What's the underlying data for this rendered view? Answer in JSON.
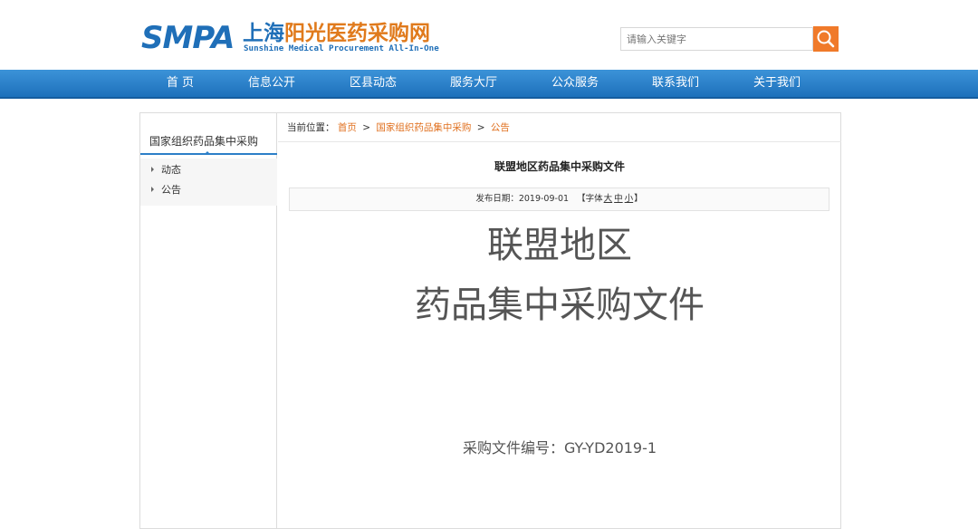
{
  "header": {
    "logo_smpa": "SMPA",
    "logo_cn_part1": "上海",
    "logo_cn_part2": "阳光医药采购网",
    "logo_en": "Sunshine Medical Procurement All-In-One",
    "search_placeholder": "请输入关键字",
    "colors": {
      "brand_blue": "#1f6fb8",
      "brand_orange": "#e07a1c",
      "search_button": "#f07a2a"
    }
  },
  "nav": {
    "items": [
      "首 页",
      "信息公开",
      "区县动态",
      "服务大厅",
      "公众服务",
      "联系我们",
      "关于我们"
    ]
  },
  "sidebar": {
    "title": "国家组织药品集中采购",
    "items": [
      "动态",
      "公告"
    ]
  },
  "breadcrumb": {
    "label": "当前位置：",
    "items": [
      "首页",
      "国家组织药品集中采购",
      "公告"
    ],
    "separator": ">"
  },
  "article": {
    "title": "联盟地区药品集中采购文件",
    "date_label": "发布日期：",
    "date": "2019-09-01",
    "font_label": "【字体",
    "font_sizes": [
      "大",
      "中",
      "小"
    ],
    "font_close": "】",
    "cover_line1": "联盟地区",
    "cover_line2": "药品集中采购文件",
    "doc_number": "采购文件编号：GY-YD2019-1"
  }
}
